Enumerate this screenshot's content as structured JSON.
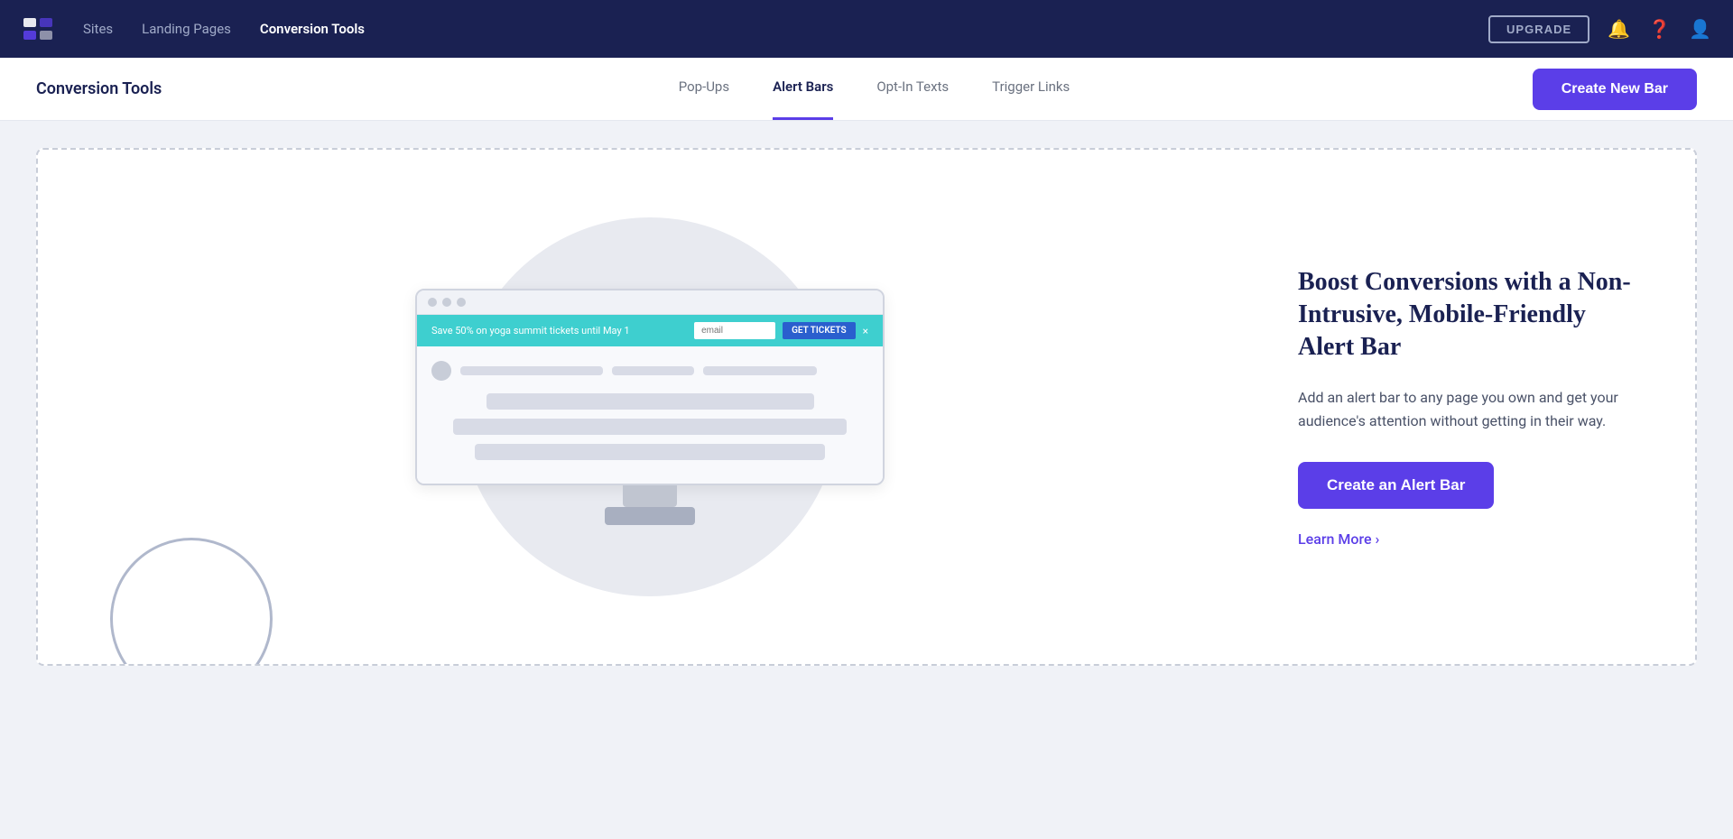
{
  "topnav": {
    "links": [
      {
        "id": "sites",
        "label": "Sites",
        "active": false
      },
      {
        "id": "landing-pages",
        "label": "Landing Pages",
        "active": false
      },
      {
        "id": "conversion-tools",
        "label": "Conversion Tools",
        "active": true
      }
    ],
    "upgrade_label": "UPGRADE",
    "notification_icon": "bell",
    "help_icon": "question",
    "user_icon": "user"
  },
  "subnav": {
    "title": "Conversion Tools",
    "tabs": [
      {
        "id": "pop-ups",
        "label": "Pop-Ups",
        "active": false
      },
      {
        "id": "alert-bars",
        "label": "Alert Bars",
        "active": true
      },
      {
        "id": "opt-in-texts",
        "label": "Opt-In Texts",
        "active": false
      },
      {
        "id": "trigger-links",
        "label": "Trigger Links",
        "active": false
      }
    ],
    "create_btn_label": "Create New Bar"
  },
  "main": {
    "heading": "Boost Conversions with a Non-Intrusive, Mobile-Friendly Alert Bar",
    "description": "Add an alert bar to any page you own and get your audience's attention without getting in their way.",
    "create_btn_label": "Create an Alert Bar",
    "learn_more_label": "Learn More",
    "alert_bar": {
      "text": "Save 50% on yoga summit tickets until May 1",
      "input_placeholder": "email",
      "cta_label": "GET TICKETS",
      "close_label": "×"
    },
    "mock_lines": [
      {
        "width": "60%"
      },
      {
        "width": "80%"
      },
      {
        "width": "70%"
      },
      {
        "width": "65%"
      }
    ]
  }
}
